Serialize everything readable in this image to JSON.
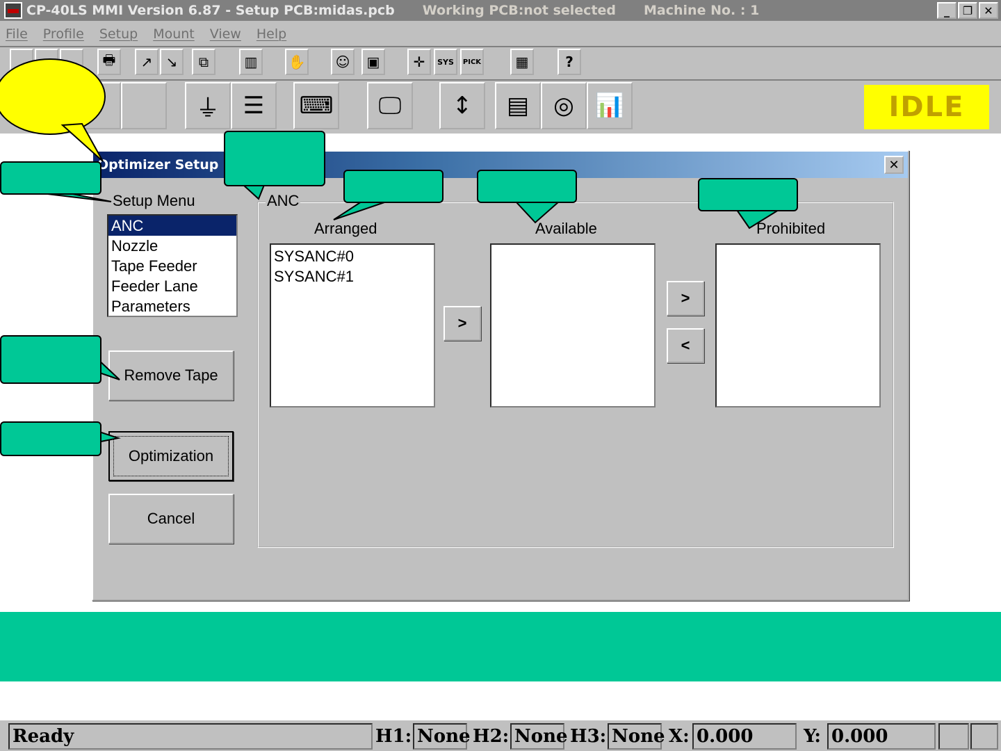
{
  "window": {
    "title": "CP-40LS MMI Version 6.87 - Setup PCB:midas.pcb",
    "working_pcb": "Working PCB:not selected",
    "machine_no": "Machine No. : 1",
    "minimize": "_",
    "restore": "❐",
    "close": "✕"
  },
  "menu": [
    "File",
    "Profile",
    "Setup",
    "Mount",
    "View",
    "Help"
  ],
  "toolbar": {
    "row1_icons": [
      "new-icon",
      "open-icon",
      "save-icon",
      "print-icon",
      "import-icon",
      "export-icon",
      "copy-icon",
      "layout-icon",
      "teach-icon",
      "smiley-icon",
      "run-icon",
      "fiducial-icon",
      "sys-icon",
      "pick-icon",
      "report-icon",
      "help-icon"
    ],
    "row1_glyphs": [
      "",
      "",
      "",
      "🖶",
      "↗",
      "↘",
      "⧉",
      "▥",
      "✋",
      "☺",
      "▣",
      "✛",
      "SYS",
      "PICK",
      "▦",
      "?"
    ],
    "row2_icons": [
      "nozzle-icon",
      "feeder-icon",
      "head-icon",
      "conveyor-icon",
      "keypad-icon",
      "monitor-icon",
      "counter-icon",
      "parts-icon",
      "tape-icon",
      "chart-icon"
    ],
    "row2_glyphs": [
      "",
      "",
      "⏚",
      "☰",
      "⌨",
      "🖵",
      "↕",
      "▤",
      "◎",
      "📊"
    ]
  },
  "status_badge": "IDLE",
  "dialog": {
    "title": "Optimizer Setup",
    "close": "✕",
    "setup_menu_label": "Setup Menu",
    "setup_menu_items": [
      "ANC",
      "Nozzle",
      "Tape Feeder",
      "Feeder Lane",
      "Parameters"
    ],
    "selected_item": "ANC",
    "remove_tape": "Remove Tape",
    "optimization": "Optimization",
    "cancel": "Cancel",
    "group_label": "ANC",
    "arranged_label": "Arranged",
    "available_label": "Available",
    "prohibited_label": "Prohibited",
    "arranged_items": [
      "SYSANC#0",
      "SYSANC#1"
    ],
    "available_items": [],
    "prohibited_items": [],
    "move_right": ">",
    "move_right_2": ">",
    "move_left": "<"
  },
  "statusbar": {
    "ready": "Ready",
    "h1_label": "H1:",
    "h1_value": "None",
    "h2_label": "H2:",
    "h2_value": "None",
    "h3_label": "H3:",
    "h3_value": "None",
    "x_label": "X:",
    "x_value": "0.000",
    "y_label": "Y:",
    "y_value": "0.000"
  },
  "colors": {
    "callout": "#00c896",
    "bubble": "#ffff00",
    "selection": "#0a246a"
  }
}
